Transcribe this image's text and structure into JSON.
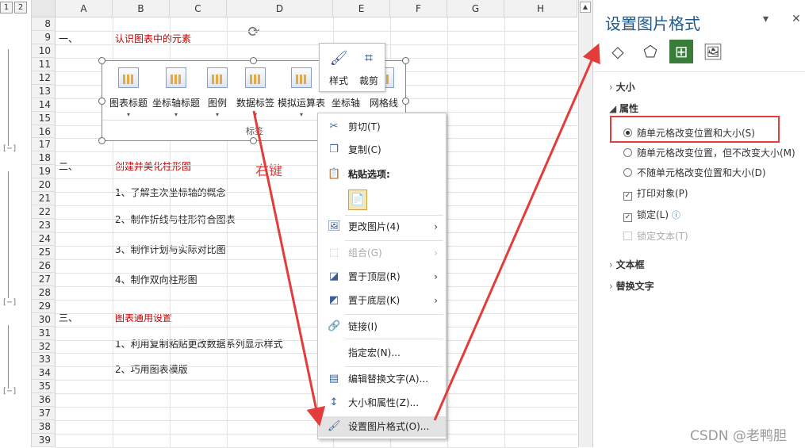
{
  "outline": {
    "levels": [
      "1",
      "2"
    ]
  },
  "columns": [
    "A",
    "B",
    "C",
    "D",
    "E",
    "F",
    "G",
    "H"
  ],
  "rows": [
    "8",
    "9",
    "10",
    "11",
    "12",
    "13",
    "14",
    "15",
    "16",
    "17",
    "18",
    "19",
    "20",
    "21",
    "22",
    "23",
    "24",
    "25",
    "26",
    "27",
    "28",
    "29",
    "30",
    "31",
    "32",
    "33",
    "34",
    "35",
    "36",
    "37",
    "38",
    "39"
  ],
  "sheet": {
    "sec1_num": "一、",
    "sec1_title": "认识图表中的元素",
    "sec2_num": "二、",
    "sec2_title": "创建并美化柱形图",
    "item1": "1、了解主次坐标轴的概念",
    "item2": "2、制作折线与柱形符合图表",
    "item3": "3、制作计划与实际对比图",
    "item4": "4、制作双向柱形图",
    "sec3_num": "三、",
    "sec3_title": "图表通用设置",
    "item5": "1、利用复制粘贴更改数据系列显示样式",
    "item6": "2、巧用图表模版",
    "annotation": "右键"
  },
  "chart": {
    "buttons": [
      "图表标题",
      "坐标轴标题",
      "图例",
      "数据标签",
      "模拟运算表",
      "坐标轴",
      "网格线"
    ],
    "group_label": "标签"
  },
  "minitoolbar": {
    "style": "样式",
    "crop": "裁剪"
  },
  "context_menu": {
    "cut": "剪切(T)",
    "copy": "复制(C)",
    "paste_options": "粘贴选项:",
    "change_picture": "更改图片(4)",
    "group": "组合(G)",
    "bring_front": "置于顶层(R)",
    "send_back": "置于底层(K)",
    "link": "链接(I)",
    "assign_macro": "指定宏(N)...",
    "edit_alt": "编辑替换文字(A)...",
    "size_props": "大小和属性(Z)...",
    "format_picture": "设置图片格式(O)..."
  },
  "pane": {
    "title": "设置图片格式",
    "size": "大小",
    "properties": "属性",
    "opt1": "随单元格改变位置和大小(S)",
    "opt2": "随单元格改变位置，但不改变大小(M)",
    "opt3": "不随单元格改变位置和大小(D)",
    "print": "打印对象(P)",
    "lock": "锁定(L)",
    "lock_text": "锁定文本(T)",
    "textbox": "文本框",
    "alt_text": "替换文字"
  },
  "watermark": "CSDN @老鸭胆",
  "colors": {
    "accent_red": "#e43b3b",
    "heading_red": "#c00000",
    "pane_title": "#1e5a8e"
  }
}
